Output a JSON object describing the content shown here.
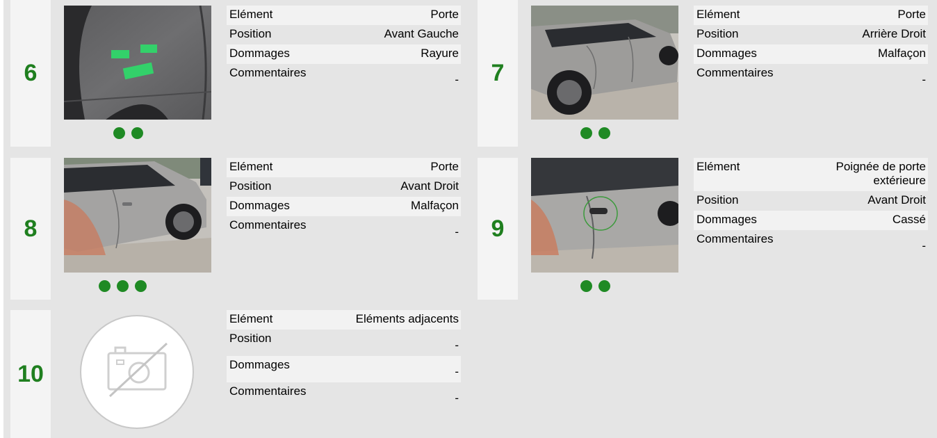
{
  "labels": {
    "element": "Elément",
    "position": "Position",
    "damages": "Dommages",
    "comments": "Commentaires"
  },
  "colors": {
    "number": "#1f7f1f",
    "dot": "#1f8a24",
    "background": "#e5e5e5",
    "number_column": "#f4f4f4",
    "row_shade": "#f2f2f2"
  },
  "items": [
    {
      "number": "6",
      "element": "Porte",
      "position": "Avant Gauche",
      "damages": "Rayure",
      "comments": "-",
      "photo_dots": 2
    },
    {
      "number": "7",
      "element": "Porte",
      "position": "Arrière Droit",
      "damages": "Malfaçon",
      "comments": "-",
      "photo_dots": 2
    },
    {
      "number": "8",
      "element": "Porte",
      "position": "Avant Droit",
      "damages": "Malfaçon",
      "comments": "-",
      "photo_dots": 3
    },
    {
      "number": "9",
      "element": "Poignée de porte extérieure",
      "position": "Avant Droit",
      "damages": "Cassé",
      "comments": "-",
      "photo_dots": 2
    },
    {
      "number": "10",
      "element": "Eléments adjacents",
      "position": "-",
      "damages": "-",
      "comments": "-",
      "photo_dots": 0
    }
  ],
  "icons": {
    "no_photo": "no-camera-icon",
    "photo_dot": "carousel-dot-icon"
  }
}
